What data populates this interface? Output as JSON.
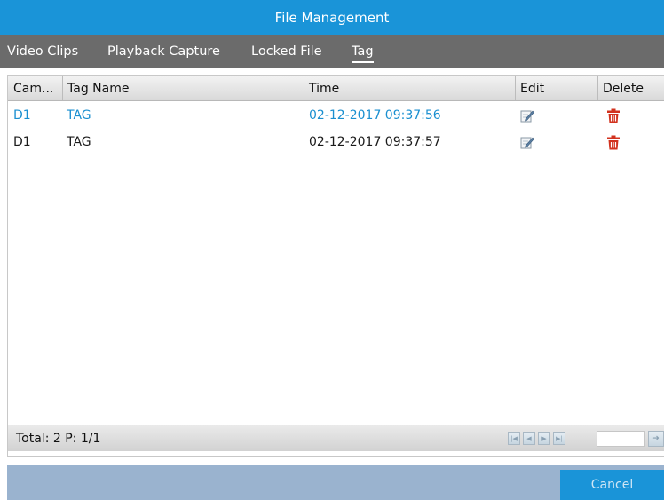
{
  "window": {
    "title": "File Management"
  },
  "tabs": [
    {
      "label": "Video Clips",
      "active": false
    },
    {
      "label": "Playback Capture",
      "active": false
    },
    {
      "label": "Locked File",
      "active": false
    },
    {
      "label": "Tag",
      "active": true
    }
  ],
  "table": {
    "columns": [
      "Cam...",
      "Tag Name",
      "Time",
      "Edit",
      "Delete"
    ],
    "rows": [
      {
        "camera": "D1",
        "tag_name": "TAG",
        "time": "02-12-2017 09:37:56",
        "edit_icon": "edit-pencil-icon",
        "delete_icon": "trash-icon",
        "selected": true
      },
      {
        "camera": "D1",
        "tag_name": "TAG",
        "time": "02-12-2017 09:37:57",
        "edit_icon": "edit-pencil-icon",
        "delete_icon": "trash-icon",
        "selected": false
      }
    ]
  },
  "status": {
    "total_text": "Total: 2 P: 1/1"
  },
  "pager": {
    "page_input_value": "",
    "icons": [
      "first-page-icon",
      "prev-page-icon",
      "next-page-icon",
      "last-page-icon",
      "go-icon"
    ]
  },
  "footer": {
    "cancel_label": "Cancel"
  },
  "colors": {
    "accent": "#1a94d8",
    "tab_bar": "#6b6b6b",
    "selected_text": "#1a8fd0",
    "delete_icon": "#d2321e",
    "footer_bar": "#9ab3cf"
  }
}
